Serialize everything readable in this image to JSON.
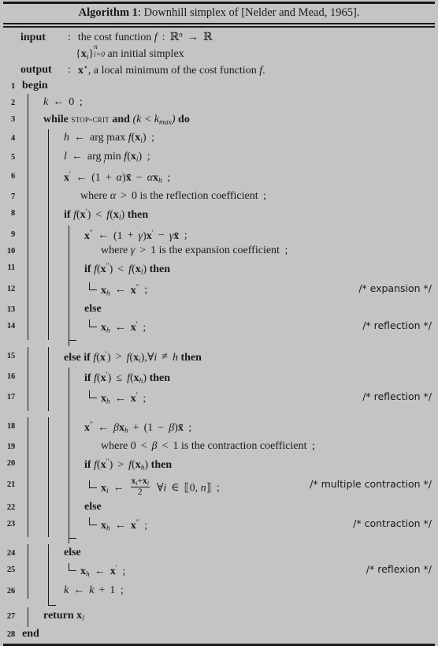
{
  "caption": {
    "label": "Algorithm 1",
    "separator": ":",
    "title": "Downhill simplex of [Nelder and Mead, 1965]."
  },
  "io": {
    "input_label": "input",
    "input_sep": ":",
    "input_text": "the cost function f : ℝn → ℝ",
    "input_cont": "{xi}ni=0 an initial simplex",
    "output_label": "output",
    "output_sep": ":",
    "output_text": "x⋆, a local minimum of the cost function f."
  },
  "lines": [
    {
      "n": "1",
      "text": "begin"
    },
    {
      "n": "2",
      "text": "k ← 0 ;"
    },
    {
      "n": "3",
      "text": "while STOP-CRIT and (k < kmax) do"
    },
    {
      "n": "4",
      "text": "h ← arg max_i f(xi) ;"
    },
    {
      "n": "5",
      "text": "l ← arg min_i f(xi) ;"
    },
    {
      "n": "6",
      "text": "x′ ← (1 + α)x̄ − αxh ;"
    },
    {
      "n": "7",
      "text": "where α > 0 is the reflection coefficient ;"
    },
    {
      "n": "8",
      "text": "if f(x′) < f(xl) then"
    },
    {
      "n": "9",
      "text": "x″ ← (1 + γ)x′ − γx̄ ;"
    },
    {
      "n": "10",
      "text": "where γ > 1 is the expansion coefficient ;"
    },
    {
      "n": "11",
      "text": "if f(x″) < f(xl) then"
    },
    {
      "n": "12",
      "text": "xh ← x″ ;",
      "comment": "/* expansion */"
    },
    {
      "n": "13",
      "text": "else"
    },
    {
      "n": "14",
      "text": "xh ← x′ ;",
      "comment": "/* reflection */"
    },
    {
      "n": "15",
      "text": "else if f(x′) > f(xi), ∀i ≠ h then"
    },
    {
      "n": "16",
      "text": "if f(x′) ≤ f(xh) then"
    },
    {
      "n": "17",
      "text": "xh ← x′ ;",
      "comment": "/* reflection */"
    },
    {
      "n": "18",
      "text": "x″ ← βxh + (1 − β)x̄ ;"
    },
    {
      "n": "19",
      "text": "where 0 < β < 1 is the contraction coefficient ;"
    },
    {
      "n": "20",
      "text": "if f(x″) > f(xh) then"
    },
    {
      "n": "21",
      "text": "xi ← (xi+xl)/2  ∀i ∈ ⟦0, n⟧ ;",
      "comment": "/* multiple contraction */"
    },
    {
      "n": "22",
      "text": "else"
    },
    {
      "n": "23",
      "text": "xh ← x″ ;",
      "comment": "/* contraction */"
    },
    {
      "n": "24",
      "text": "else"
    },
    {
      "n": "25",
      "text": "xh ← x′ ;",
      "comment": "/* reflexion */"
    },
    {
      "n": "26",
      "text": "k ← k + 1 ;"
    },
    {
      "n": "27",
      "text": "return xl"
    },
    {
      "n": "28",
      "text": "end"
    }
  ],
  "keywords": {
    "begin": "begin",
    "end": "end",
    "while": "while",
    "do": "do",
    "if": "if",
    "then": "then",
    "else": "else",
    "else_if": "else if",
    "return": "return",
    "stop_crit": "stop-crit",
    "and": "and",
    "where": "where"
  },
  "comments": {
    "expansion": "/* expansion */",
    "reflection": "/* reflection */",
    "multiple_contraction": "/* multiple contraction */",
    "contraction": "/* contraction */",
    "reflexion": "/* reflexion */"
  },
  "colors": {
    "background": "#c4c4c4",
    "ink": "#1a1a1a"
  }
}
